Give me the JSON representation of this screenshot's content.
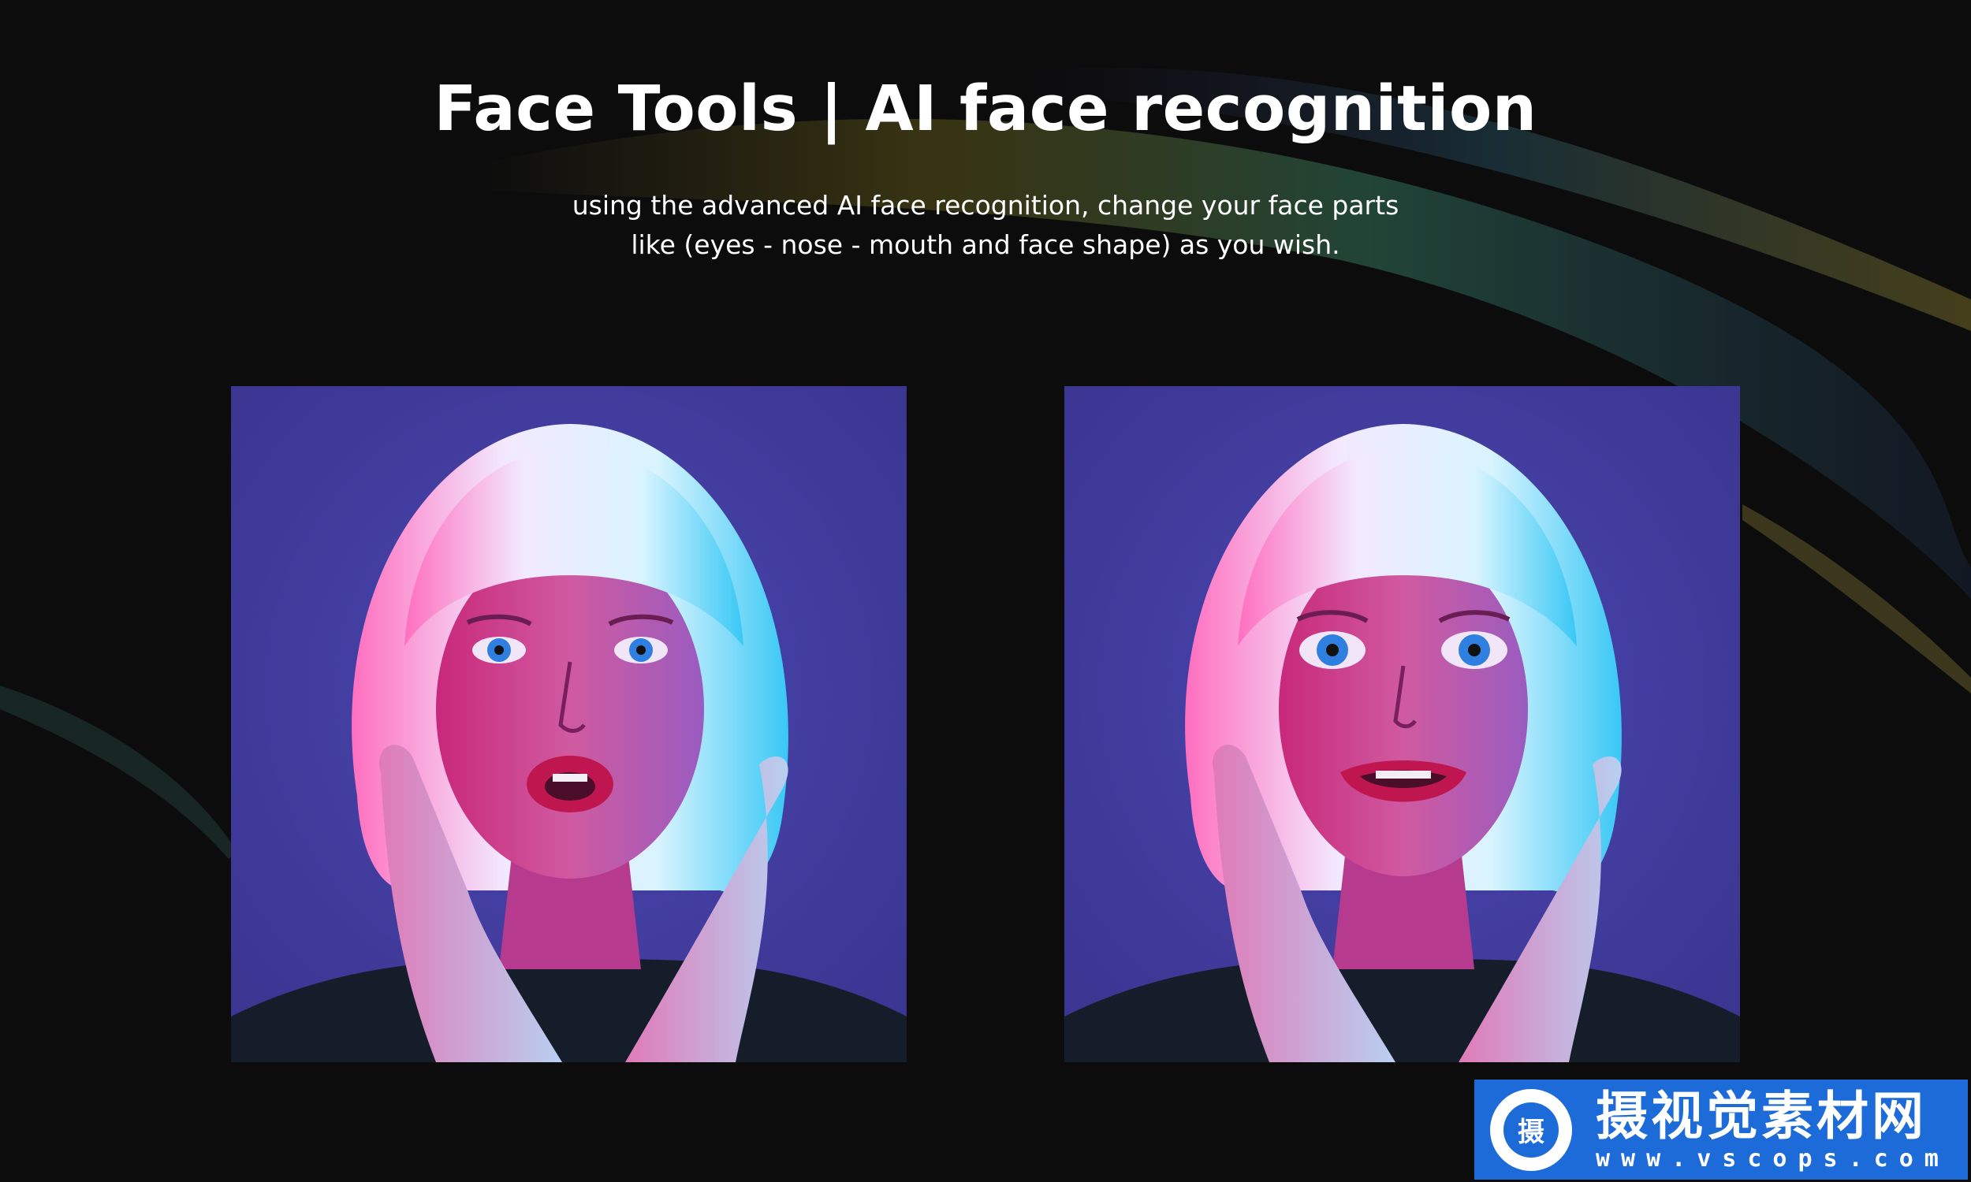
{
  "header": {
    "title": "Face Tools | AI face recognition",
    "subtitle_line1": "using the advanced AI face recognition, change your face parts",
    "subtitle_line2": "like (eyes - nose - mouth and face shape) as you wish."
  },
  "comparison": {
    "before_image": "woman-portrait-original",
    "after_image": "woman-portrait-edited"
  },
  "watermark": {
    "logo_glyph": "摄",
    "title": "摄视觉素材网",
    "url": "www.vscops.com"
  },
  "colors": {
    "background": "#0c0c0d",
    "photo_backdrop": "#3f3b9a",
    "watermark_bg": "#1d6bd9",
    "text": "#ffffff"
  }
}
